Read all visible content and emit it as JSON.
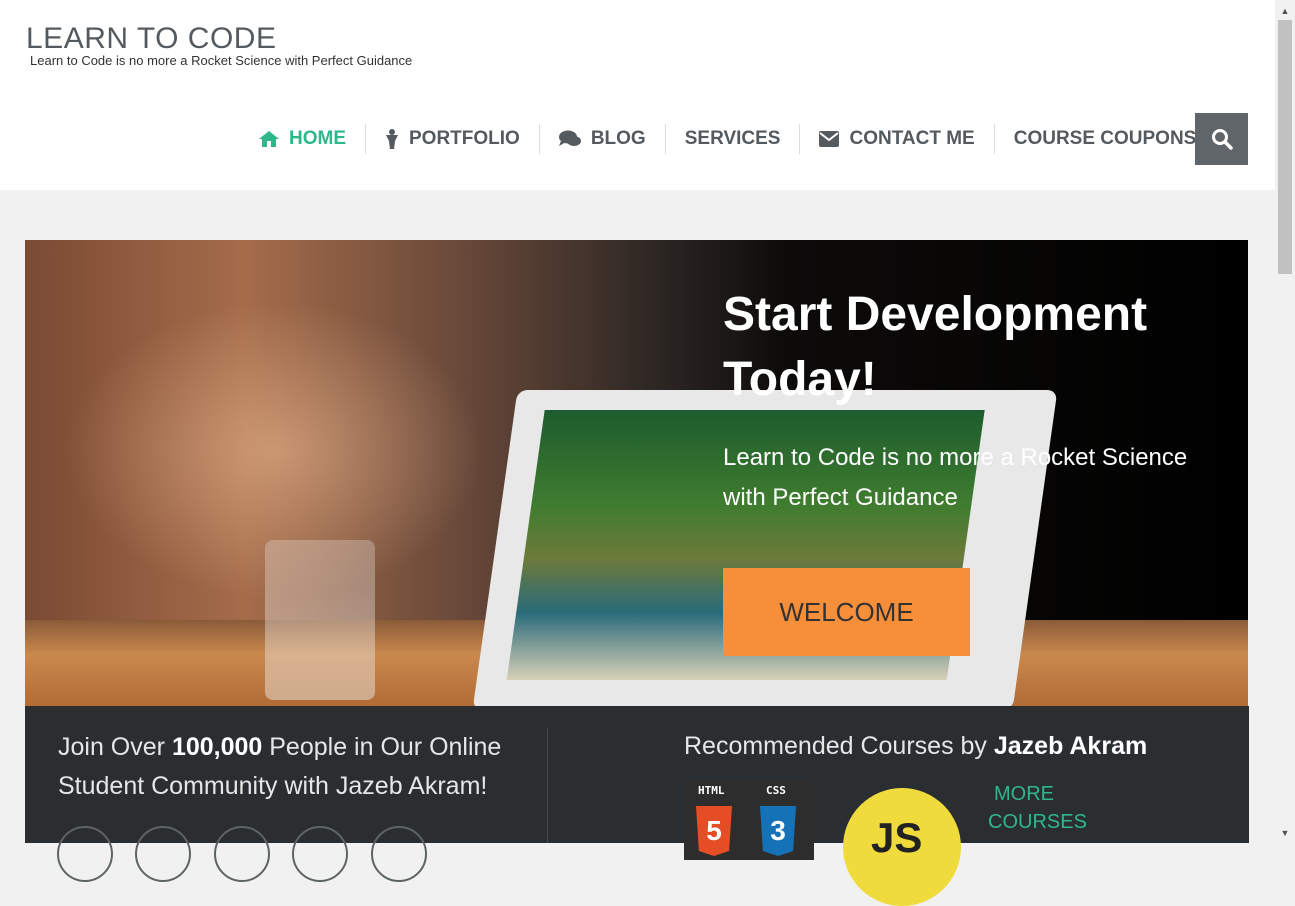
{
  "site": {
    "title": "LEARN TO CODE",
    "tagline": "Learn to Code is no more a Rocket Science with Perfect Guidance"
  },
  "nav": {
    "items": [
      {
        "label": "HOME",
        "icon": "home-icon",
        "active": true
      },
      {
        "label": "PORTFOLIO",
        "icon": "person-icon"
      },
      {
        "label": "BLOG",
        "icon": "comments-icon"
      },
      {
        "label": "SERVICES",
        "icon": ""
      },
      {
        "label": "CONTACT ME",
        "icon": "envelope-icon"
      },
      {
        "label": "COURSE COUPONS",
        "icon": ""
      }
    ],
    "search_icon": "search-icon"
  },
  "hero": {
    "title": "Start Development Today!",
    "subtitle": "Learn to Code is no more a Rocket Science with Perfect Guidance",
    "button": "WELCOME"
  },
  "community": {
    "text_before": "Join Over ",
    "count": "100,000",
    "text_after": " People in Our Online Student Community with Jazeb Akram!"
  },
  "courses": {
    "title_prefix": "Recommended Courses by ",
    "author": "Jazeb Akram",
    "html_label": "HTML",
    "css_label": "CSS",
    "html_num": "5",
    "css_num": "3",
    "js_label": "JS",
    "more_line1": "MORE",
    "more_line2": "COURSES"
  },
  "colors": {
    "accent": "#2eb88a",
    "button": "#f78f3a",
    "band": "#2a2e30",
    "search_bg": "#5f6569"
  }
}
